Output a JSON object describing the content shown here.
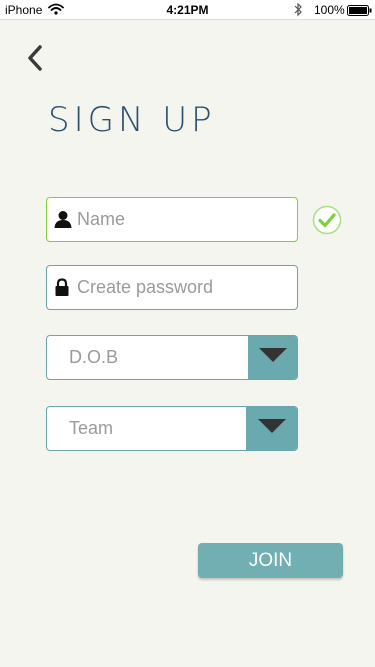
{
  "status_bar": {
    "carrier": "iPhone",
    "time": "4:21PM",
    "battery_percent": "100%"
  },
  "page": {
    "title": "SIGN UP"
  },
  "form": {
    "name_placeholder": "Name",
    "password_placeholder": "Create password",
    "dob_value": "D.O.B",
    "team_value": "Team",
    "join_label": "JOIN"
  },
  "colors": {
    "background": "#f4f5ef",
    "title": "#2d4f6c",
    "field_border": "#6aa5a9",
    "valid_border": "#7fcf3a",
    "select_toggle": "#6aa9ad",
    "join_button": "#72afb3"
  },
  "icons": {
    "back": "chevron-left-icon",
    "name": "user-icon",
    "password": "lock-icon",
    "valid": "check-circle-icon",
    "dropdown": "caret-down-icon"
  }
}
